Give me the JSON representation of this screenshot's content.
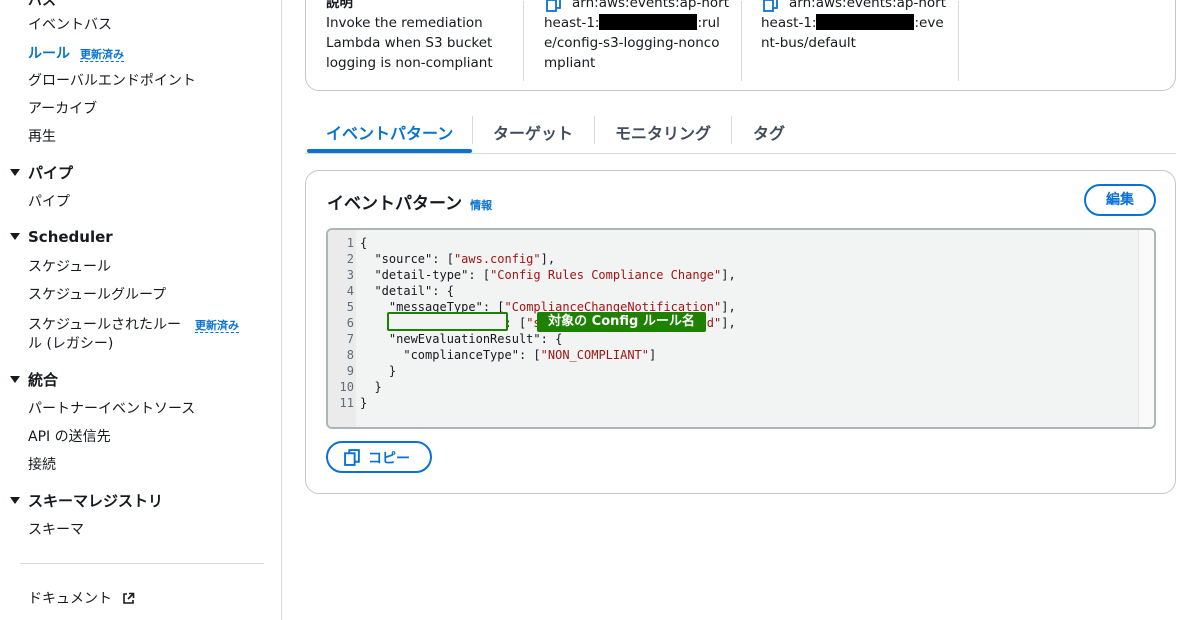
{
  "sidebar": {
    "cut_top": "バス",
    "items_a": [
      {
        "label": "イベントバス"
      },
      {
        "label": "ルール",
        "badge": "更新済み"
      },
      {
        "label": "グローバルエンドポイント"
      },
      {
        "label": "アーカイブ"
      },
      {
        "label": "再生"
      }
    ],
    "pipes": {
      "heading": "パイプ",
      "items": [
        "パイプ"
      ]
    },
    "scheduler": {
      "heading": "Scheduler",
      "items": [
        "スケジュール",
        "スケジュールグループ"
      ],
      "legacy_line1": "スケジュールされたルー",
      "legacy_line2": "ル (レガシー)",
      "legacy_badge": "更新済み"
    },
    "integration": {
      "heading": "統合",
      "items": [
        "パートナーイベントソース",
        "API の送信先",
        "接続"
      ]
    },
    "schema": {
      "heading": "スキーマレジストリ",
      "items": [
        "スキーマ"
      ]
    },
    "docs": "ドキュメント"
  },
  "top_card": {
    "desc_heading": "説明",
    "desc_lines": [
      "Invoke the remediation",
      "Lambda when S3 bucket",
      "logging is non-compliant"
    ],
    "arn1_top": "arn:aws:events:ap-nort",
    "arn1_line2a": "heast-1:",
    "arn1_line2b": ":rul",
    "arn1_line3": "e/config-s3-logging-nonco",
    "arn1_line4": "mpliant",
    "arn2_top": "arn:aws:events:ap-nort",
    "arn2_line2a": "heast-1:",
    "arn2_line2b": ":eve",
    "arn2_line3": "nt-bus/default"
  },
  "tabs": [
    "イベントパターン",
    "ターゲット",
    "モニタリング",
    "タグ"
  ],
  "pattern": {
    "title": "イベントパターン",
    "info": "情報",
    "edit": "編集",
    "copy": "コピー",
    "annotation": "対象の Config ルール名",
    "code": [
      {
        "n": "1",
        "t": "{"
      },
      {
        "n": "2",
        "t": "  \"source\": [\"aws.config\"],"
      },
      {
        "n": "3",
        "t": "  \"detail-type\": [\"Config Rules Compliance Change\"],"
      },
      {
        "n": "4",
        "t": "  \"detail\": {"
      },
      {
        "n": "5",
        "t": "    \"messageType\": [\"ComplianceChangeNotification\"],"
      },
      {
        "n": "6",
        "t": "    \"configRuleName\": [\"s3-bucket-logging-enabled\"],"
      },
      {
        "n": "7",
        "t": "    \"newEvaluationResult\": {"
      },
      {
        "n": "8",
        "t": "      \"complianceType\": [\"NON_COMPLIANT\"]"
      },
      {
        "n": "9",
        "t": "    }"
      },
      {
        "n": "10",
        "t": "  }"
      },
      {
        "n": "11",
        "t": "}"
      }
    ]
  },
  "colors": {
    "accent": "#0972d3",
    "highlight": "#1d8102",
    "string": "#a31515"
  }
}
